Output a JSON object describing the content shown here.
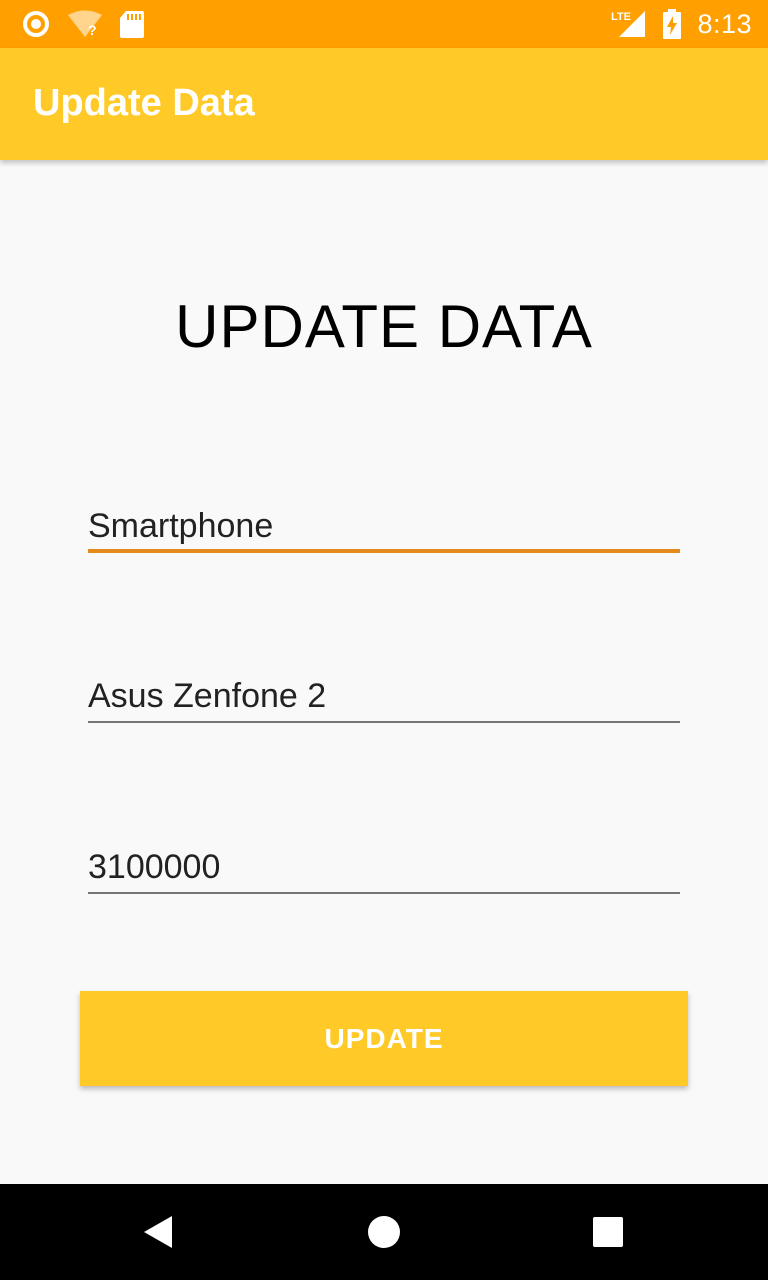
{
  "status_bar": {
    "time": "8:13",
    "network_label": "LTE",
    "icons": [
      "notification-circle-icon",
      "wifi-unknown-icon",
      "sd-card-icon",
      "lte-signal-icon",
      "battery-charging-icon"
    ]
  },
  "app_bar": {
    "title": "Update Data"
  },
  "form": {
    "heading": "UPDATE DATA",
    "fields": [
      {
        "value": "Smartphone",
        "focused": true
      },
      {
        "value": "Asus Zenfone 2",
        "focused": false
      },
      {
        "value": "3100000",
        "focused": false
      }
    ],
    "submit_label": "UPDATE"
  },
  "nav_bar": {
    "icons": [
      "back-icon",
      "home-icon",
      "recents-icon"
    ]
  },
  "colors": {
    "status_bar": "#ffa000",
    "app_bar": "#ffca28",
    "accent": "#e5891d",
    "background": "#f9f9f9"
  }
}
